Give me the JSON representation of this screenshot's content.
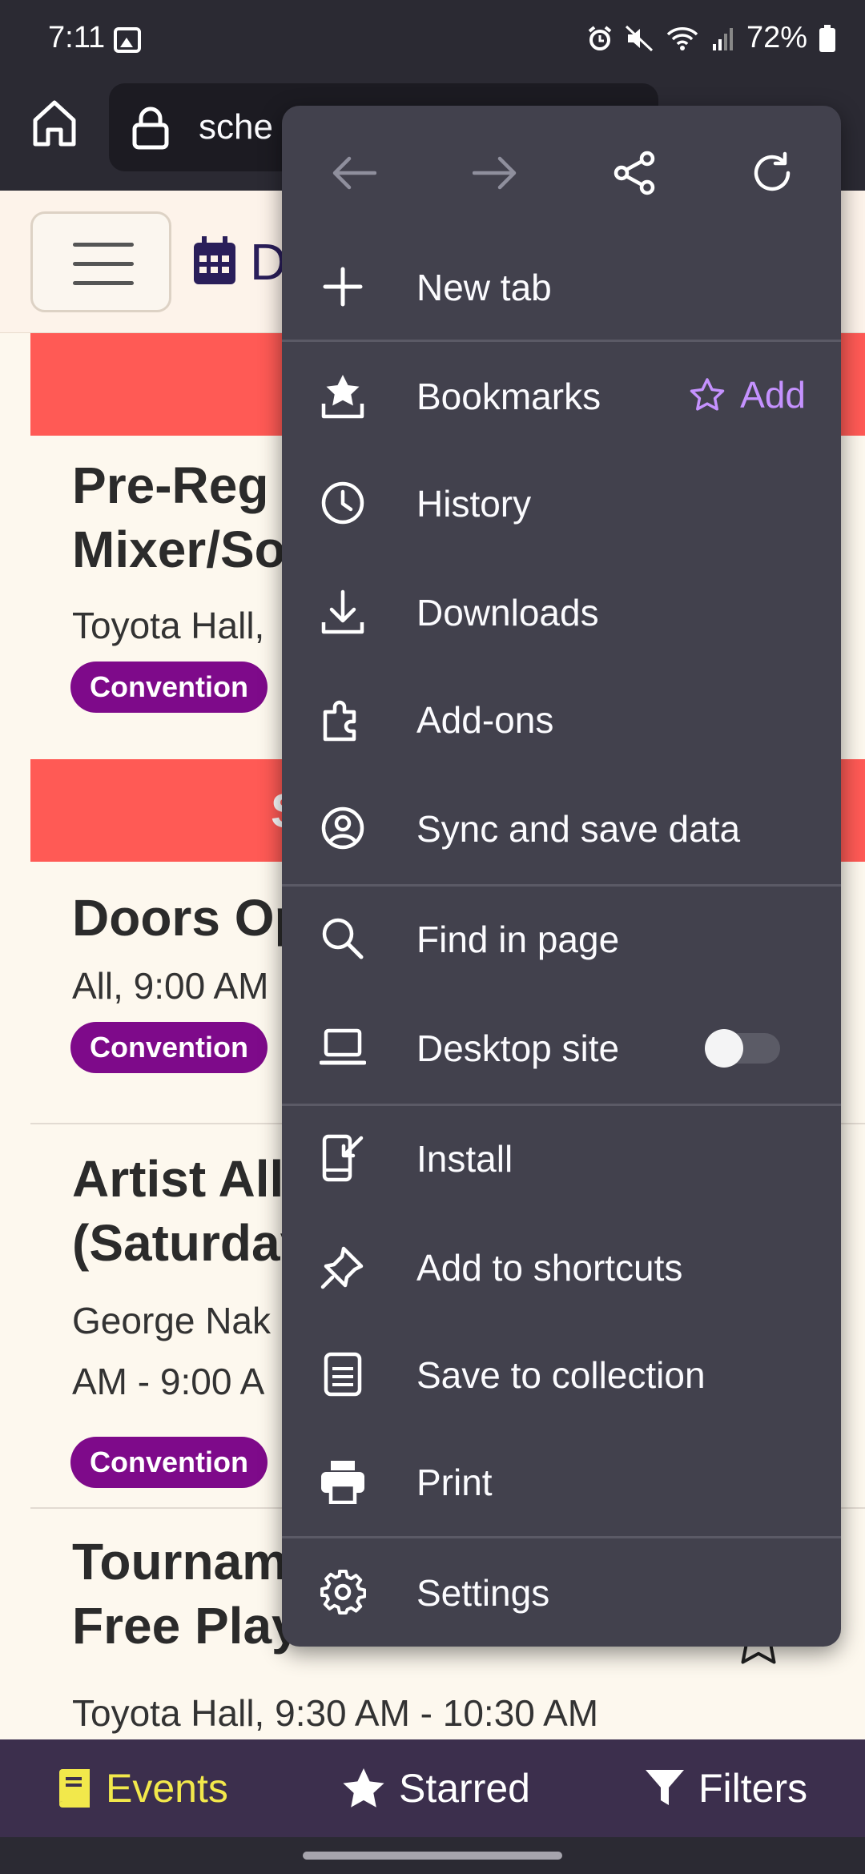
{
  "status_bar": {
    "time": "7:11",
    "battery": "72%",
    "icons": [
      "gallery-icon",
      "alarm-icon",
      "mute-icon",
      "wifi-icon",
      "signal-icon",
      "battery-icon"
    ]
  },
  "browser": {
    "url_visible": "sche",
    "icons": [
      "home-icon",
      "lock-icon"
    ]
  },
  "page": {
    "title_visible": "D",
    "banners": [
      "",
      "S"
    ],
    "events": [
      {
        "title_lines": [
          "Pre-Reg",
          "Mixer/So"
        ],
        "meta_lines": [
          "Toyota Hall,"
        ],
        "tag": "Convention"
      },
      {
        "title_lines": [
          "Doors Op"
        ],
        "meta_lines": [
          "All, 9:00 AM"
        ],
        "tag": "Convention"
      },
      {
        "title_lines": [
          "Artist All",
          "(Saturday"
        ],
        "meta_lines": [
          "George Nak",
          "AM - 9:00 A"
        ],
        "tag": "Convention"
      },
      {
        "title_lines": [
          "Tournam",
          "Free Play"
        ],
        "meta_lines": [
          "Toyota Hall, 9:30 AM - 10:30 AM"
        ],
        "tag": ""
      }
    ]
  },
  "tabbar": {
    "events": "Events",
    "starred": "Starred",
    "filters": "Filters",
    "active_color": "#f2e84b"
  },
  "menu": {
    "nav_icons": [
      "back-arrow-icon",
      "forward-arrow-icon",
      "share-icon",
      "reload-icon"
    ],
    "items": [
      {
        "label": "New tab",
        "icon": "plus-icon"
      },
      {
        "label": "Bookmarks",
        "icon": "bookmarks-icon",
        "action": "Add"
      },
      {
        "label": "History",
        "icon": "clock-icon"
      },
      {
        "label": "Downloads",
        "icon": "download-icon"
      },
      {
        "label": "Add-ons",
        "icon": "puzzle-icon"
      },
      {
        "label": "Sync and save data",
        "icon": "account-icon"
      },
      {
        "label": "Find in page",
        "icon": "search-icon"
      },
      {
        "label": "Desktop site",
        "icon": "laptop-icon",
        "toggle": "off"
      },
      {
        "label": "Install",
        "icon": "install-icon"
      },
      {
        "label": "Add to shortcuts",
        "icon": "pin-icon"
      },
      {
        "label": "Save to collection",
        "icon": "collection-icon"
      },
      {
        "label": "Print",
        "icon": "printer-icon"
      },
      {
        "label": "Settings",
        "icon": "gear-icon"
      }
    ],
    "accent_color": "#c592ff",
    "background_color": "#42414d"
  }
}
